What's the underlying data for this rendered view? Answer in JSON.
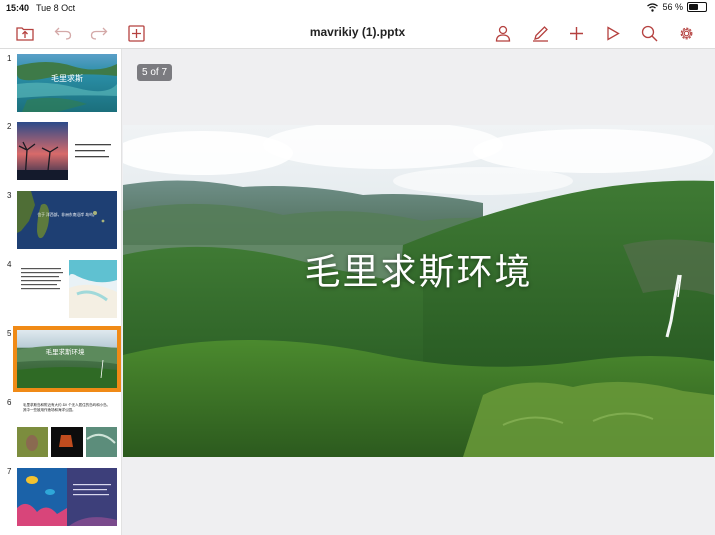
{
  "status": {
    "time": "15:40",
    "date": "Tue 8 Oct",
    "battery": "56 %",
    "battery_level": 0.56
  },
  "toolbar": {
    "title": "mavrikiy (1).pptx",
    "icons_left": [
      "folder-up-icon",
      "undo-icon",
      "redo-icon",
      "insert-icon"
    ],
    "icons_right": [
      "person-icon",
      "pen-icon",
      "plus-icon",
      "play-icon",
      "search-icon",
      "gear-icon"
    ],
    "accent": "#b5413f"
  },
  "slides": {
    "thumbnails": [
      {
        "num": "1",
        "title": "毛里求斯"
      },
      {
        "num": "2"
      },
      {
        "num": "3",
        "title": "位于    洋西部，非洲东南沿岸    岛屿。"
      },
      {
        "num": "4"
      },
      {
        "num": "5",
        "title": "毛里求斯环境",
        "selected": true
      },
      {
        "num": "6",
        "title": "毛里求斯岛和附近有大约 40 个无人居住的岛屿和小岛。其中一些被用作渔场和海洋公园。"
      },
      {
        "num": "7"
      }
    ],
    "selected_color": "#f08a16"
  },
  "main": {
    "page_indicator": "5 of 7",
    "slide_title": "毛里求斯环境"
  }
}
